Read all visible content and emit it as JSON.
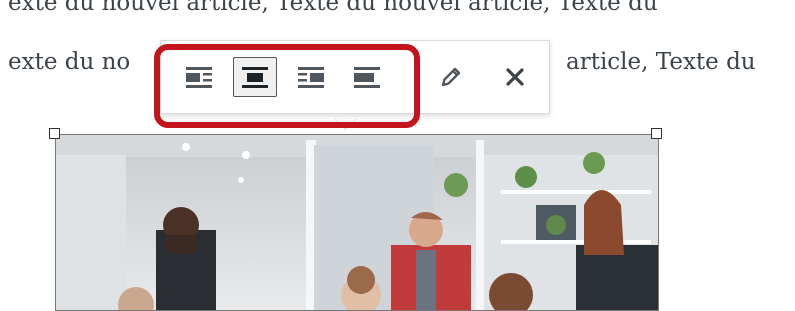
{
  "editor": {
    "line1": "exte du nouvel article, Texte du nouvel article, Texte du",
    "line2_start": "exte du no",
    "line2_end": "article, Texte du"
  },
  "toolbar": {
    "buttons": [
      {
        "id": "align-left",
        "icon": "align-left-icon",
        "active": false
      },
      {
        "id": "align-center",
        "icon": "align-center-icon",
        "active": true
      },
      {
        "id": "align-right",
        "icon": "align-right-icon",
        "active": false
      },
      {
        "id": "align-none",
        "icon": "align-none-icon",
        "active": false
      },
      {
        "id": "edit",
        "icon": "pencil-icon",
        "active": false
      },
      {
        "id": "remove",
        "icon": "close-icon",
        "active": false
      }
    ],
    "icon_color": "#50575e",
    "highlight_color": "#c4141c"
  },
  "image": {
    "content": "office-meeting-photo"
  }
}
